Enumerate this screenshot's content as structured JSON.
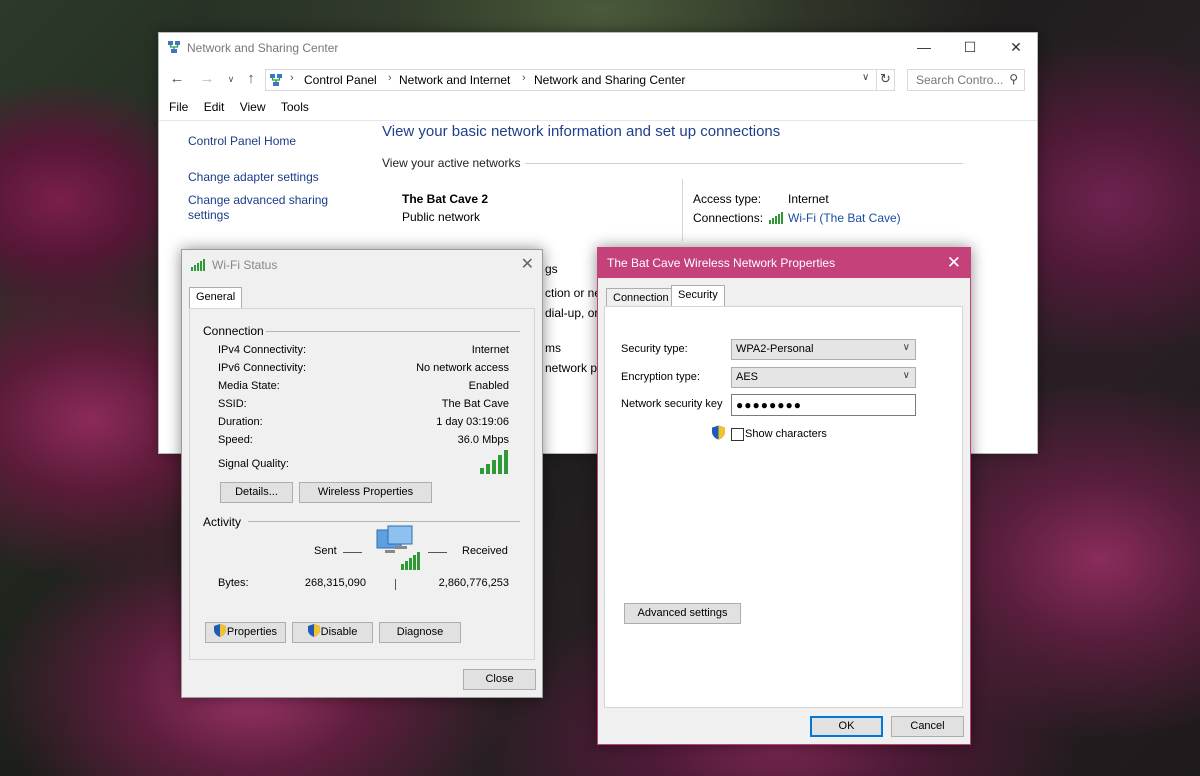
{
  "main_window": {
    "title": "Network and Sharing Center",
    "breadcrumb": [
      "Control Panel",
      "Network and Internet",
      "Network and Sharing Center"
    ],
    "search_placeholder": "Search Contro...",
    "menu": [
      "File",
      "Edit",
      "View",
      "Tools"
    ],
    "left_links": {
      "home": "Control Panel Home",
      "adapter": "Change adapter settings",
      "sharing_line1": "Change advanced sharing",
      "sharing_line2": "settings"
    },
    "heading": "View your basic network information and set up connections",
    "active_networks_label": "View your active networks",
    "network_name": "The Bat Cave  2",
    "network_type": "Public network",
    "access_type_label": "Access type:",
    "access_type_value": "Internet",
    "connections_label": "Connections:",
    "connections_value": "Wi-Fi (The Bat Cave)",
    "peek_texts": [
      "gs",
      "ction or net",
      "dial-up, or",
      "ms",
      "network p"
    ]
  },
  "wifi_status": {
    "title": "Wi-Fi Status",
    "tab": "General",
    "connection_group": "Connection",
    "rows": [
      {
        "label": "IPv4 Connectivity:",
        "value": "Internet"
      },
      {
        "label": "IPv6 Connectivity:",
        "value": "No network access"
      },
      {
        "label": "Media State:",
        "value": "Enabled"
      },
      {
        "label": "SSID:",
        "value": "The Bat Cave"
      },
      {
        "label": "Duration:",
        "value": "1 day 03:19:06"
      },
      {
        "label": "Speed:",
        "value": "36.0 Mbps"
      }
    ],
    "signal_label": "Signal Quality:",
    "details_button": "Details...",
    "wireless_props_button": "Wireless Properties",
    "activity_group": "Activity",
    "sent_label": "Sent",
    "received_label": "Received",
    "bytes_label": "Bytes:",
    "bytes_sent": "268,315,090",
    "bytes_received": "2,860,776,253",
    "properties_button": "Properties",
    "disable_button": "Disable",
    "diagnose_button": "Diagnose",
    "close_button": "Close"
  },
  "wireless_props": {
    "title": "The Bat Cave Wireless Network Properties",
    "tabs": [
      "Connection",
      "Security"
    ],
    "security_type_label": "Security type:",
    "security_type_value": "WPA2-Personal",
    "encryption_type_label": "Encryption type:",
    "encryption_type_value": "AES",
    "key_label": "Network security key",
    "key_value": "●●●●●●●●",
    "show_characters": "Show characters",
    "advanced_button": "Advanced settings",
    "ok_button": "OK",
    "cancel_button": "Cancel"
  },
  "colors": {
    "accent_titlebar": "#c4417a",
    "link_blue": "#1a3c8a",
    "signal_green": "#2e9a36"
  }
}
